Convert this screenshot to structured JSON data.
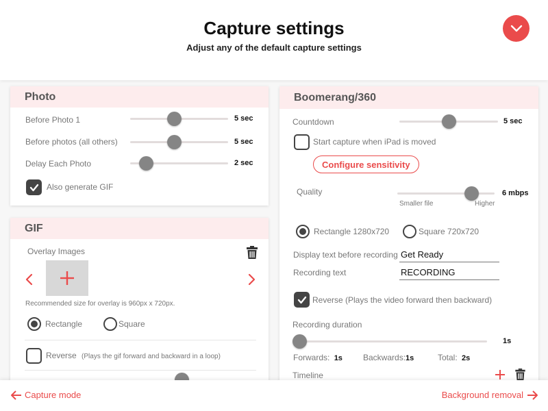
{
  "header": {
    "title": "Capture settings",
    "subtitle": "Adjust any of the default capture settings",
    "collapse_icon": "chevron-down-icon"
  },
  "colors": {
    "accent": "#ea4b4b",
    "card_header_bg": "#fdeced",
    "thumb": "#858585",
    "checkbox_dark": "#444444"
  },
  "photo": {
    "title": "Photo",
    "sliders": [
      {
        "label": "Before Photo 1",
        "value": "5 sec",
        "fraction": 0.45
      },
      {
        "label": "Before photos (all others)",
        "value": "5 sec",
        "fraction": 0.45
      },
      {
        "label": "Delay Each Photo",
        "value": "2 sec",
        "fraction": 0.16
      }
    ],
    "also_generate_gif": {
      "label": "Also generate GIF",
      "checked": true
    }
  },
  "gif": {
    "title": "GIF",
    "overlay_label": "Overlay Images",
    "overlay_hint": "Recommended size for overlay is 960px x 720px.",
    "shape_options": [
      {
        "label": "Rectangle",
        "selected": true
      },
      {
        "label": "Square",
        "selected": false
      }
    ],
    "reverse": {
      "label": "Reverse",
      "hint": "(Plays the gif forward and backward in a loop)",
      "checked": false
    }
  },
  "boomerang": {
    "title": "Boomerang/360",
    "countdown": {
      "label": "Countdown",
      "value": "5 sec",
      "fraction": 0.5
    },
    "start_on_move": {
      "label": "Start capture when iPad is moved",
      "checked": false
    },
    "configure_sensitivity": "Configure sensitivity",
    "quality": {
      "label": "Quality",
      "value": "6 mbps",
      "fraction": 0.76,
      "min_label": "Smaller file",
      "max_label": "Higher"
    },
    "resolution_options": [
      {
        "label": "Rectangle 1280x720",
        "selected": true
      },
      {
        "label": "Square 720x720",
        "selected": false
      }
    ],
    "display_text": {
      "label": "Display text before recording",
      "value": "Get Ready"
    },
    "recording_text": {
      "label": "Recording text",
      "value": "RECORDING"
    },
    "reverse": {
      "label": "Reverse (Plays the video forward then backward)",
      "checked": true
    },
    "recording_duration": {
      "label": "Recording duration",
      "value": "1s",
      "fraction": 0.0
    },
    "forwards": {
      "label": "Forwards:",
      "value": "1s"
    },
    "backwards": {
      "label": "Backwards:",
      "value": "1s"
    },
    "total": {
      "label": "Total:",
      "value": "2s"
    },
    "timeline_label": "Timeline"
  },
  "footer": {
    "back_label": "Capture mode",
    "next_label": "Background removal"
  }
}
